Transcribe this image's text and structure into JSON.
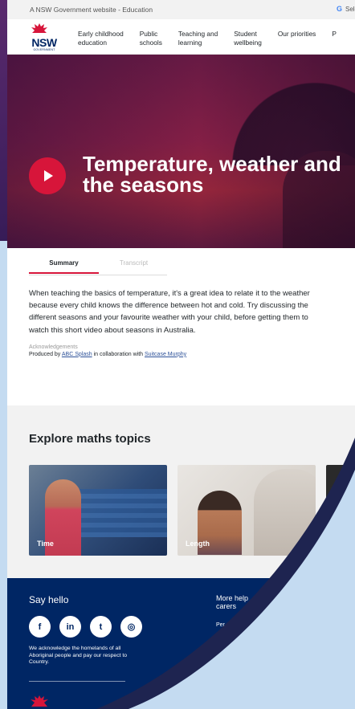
{
  "gov_strip": {
    "text": "A NSW Government website - Education",
    "translate_g": "G",
    "translate_label": "Sele"
  },
  "header": {
    "logo_text": "NSW",
    "logo_sub": "GOVERNMENT",
    "nav": [
      {
        "label": "Early childhood\neducation"
      },
      {
        "label": "Public\nschools"
      },
      {
        "label": "Teaching and\nlearning"
      },
      {
        "label": "Student\nwellbeing"
      },
      {
        "label": "Our priorities"
      },
      {
        "label": "P"
      }
    ]
  },
  "hero": {
    "title": "Temperature, weather and the seasons"
  },
  "tabs": [
    {
      "label": "Summary",
      "active": true
    },
    {
      "label": "Transcript",
      "active": false
    }
  ],
  "summary": {
    "body": "When teaching the basics of temperature, it's a great idea to relate it to the weather because every child knows the difference between hot and cold. Try discussing the different seasons and your favourite weather with your child, before getting them to watch this short video about seasons in Australia.",
    "ack_label": "Acknowledgements",
    "ack_prefix": "Produced by ",
    "ack_link1": "ABC Splash",
    "ack_middle": " in collaboration with ",
    "ack_link2": "Suitcase Murphy"
  },
  "explore": {
    "heading": "Explore maths topics",
    "cards": [
      {
        "label": "Time"
      },
      {
        "label": "Length"
      }
    ]
  },
  "footer": {
    "say_hello": "Say hello",
    "socials": [
      {
        "icon": "facebook-icon",
        "glyph": "f"
      },
      {
        "icon": "linkedin-icon",
        "glyph": "in"
      },
      {
        "icon": "twitter-icon",
        "glyph": "t"
      },
      {
        "icon": "instagram-icon",
        "glyph": "◎"
      }
    ],
    "acknowledgement": "We acknowledge the homelands of all Aboriginal people and pay our respect to Country.",
    "more_help": "More help\ncarers",
    "per": "Per"
  },
  "colors": {
    "nsw_blue": "#002664",
    "nsw_red": "#d7153a",
    "background_blue": "#c4dbf1"
  }
}
